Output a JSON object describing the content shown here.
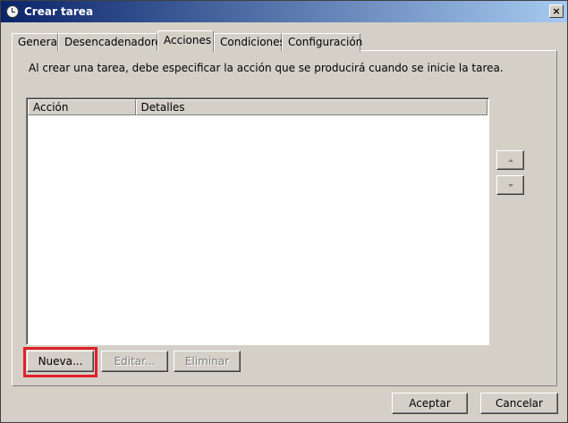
{
  "window": {
    "title": "Crear tarea",
    "close_glyph": "×"
  },
  "tabs": [
    {
      "label": "General"
    },
    {
      "label": "Desencadenadores"
    },
    {
      "label": "Acciones"
    },
    {
      "label": "Condiciones"
    },
    {
      "label": "Configuración"
    }
  ],
  "active_tab": "Acciones",
  "actions_tab": {
    "description": "Al crear una tarea, debe especificar la acción que se producirá cuando se inicie la tarea.",
    "list": {
      "columns": [
        {
          "label": "Acción"
        },
        {
          "label": "Detalles"
        }
      ],
      "rows": []
    },
    "buttons": {
      "new": "Nueva...",
      "edit": "Editar...",
      "delete": "Eliminar"
    }
  },
  "dialog_buttons": {
    "ok": "Aceptar",
    "cancel": "Cancelar"
  },
  "colors": {
    "highlight": "#e0202a",
    "titlebar_start": "#0a246a",
    "titlebar_end": "#a6caf0"
  }
}
